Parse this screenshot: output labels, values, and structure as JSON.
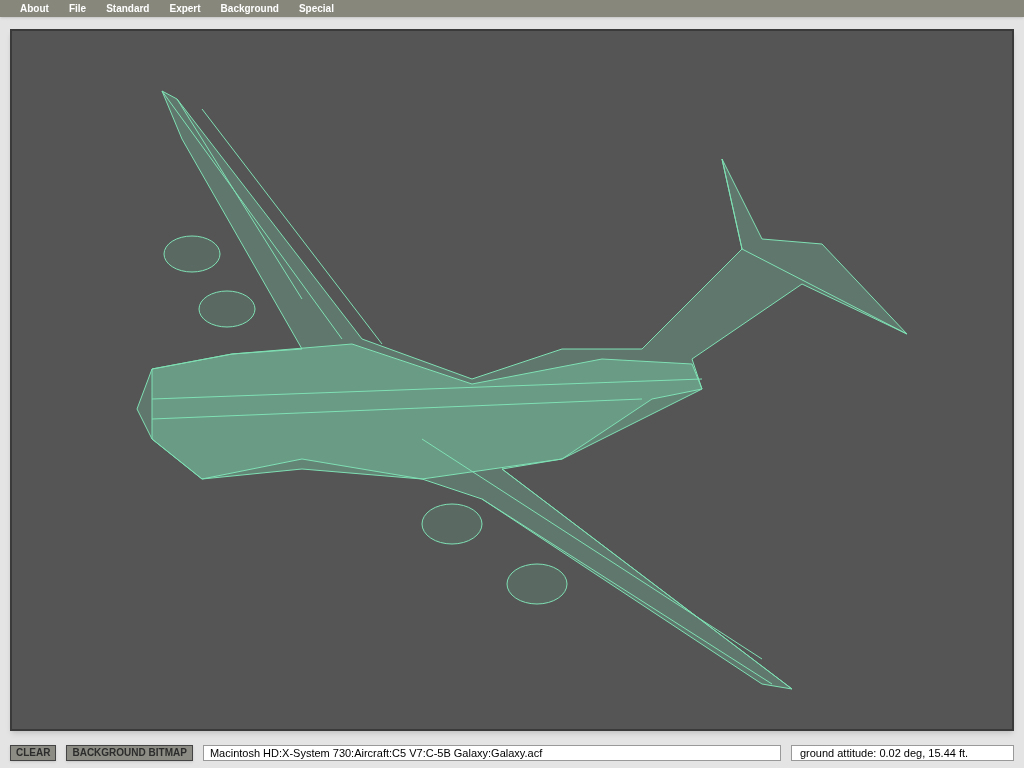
{
  "menu_bar": [
    "About",
    "File",
    "Standard",
    "Expert",
    "Background",
    "Special"
  ],
  "buttons": [
    "CLEAR",
    "BACKGROUND BITMAP"
  ],
  "file_path": "Macintosh HD:X-System 730:Aircraft:C5 V7:C-5B Galaxy:Galaxy.acf",
  "status": "ground attitude: 0.02 deg, 15.44 ft."
}
